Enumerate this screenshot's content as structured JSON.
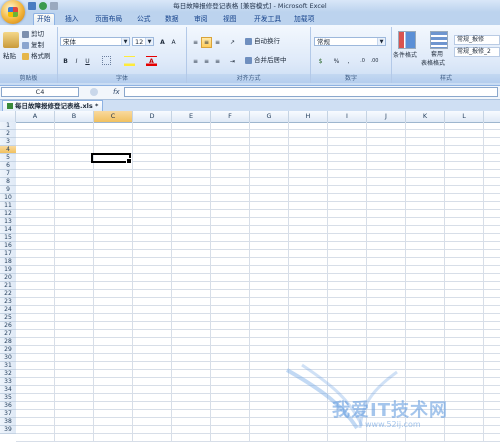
{
  "window": {
    "title": "每日故障报修登记表格 [兼容模式] - Microsoft Excel"
  },
  "tabs": [
    {
      "label": "开始",
      "active": true
    },
    {
      "label": "插入"
    },
    {
      "label": "页面布局"
    },
    {
      "label": "公式"
    },
    {
      "label": "数据"
    },
    {
      "label": "审阅"
    },
    {
      "label": "视图"
    },
    {
      "label": "开发工具"
    },
    {
      "label": "加载项"
    }
  ],
  "clipboard": {
    "paste": "粘贴",
    "cut": "剪切",
    "copy": "复制",
    "format_painter": "格式刷",
    "group_label": "剪贴板"
  },
  "font": {
    "name": "宋体",
    "size": "12",
    "bold": "B",
    "italic": "I",
    "underline": "U",
    "font_color": "A",
    "group_label": "字体"
  },
  "alignment": {
    "wrap_text": "自动换行",
    "merge_center": "合并后居中",
    "group_label": "对齐方式"
  },
  "number": {
    "format": "常规",
    "percent": "%",
    "comma": ",",
    "group_label": "数字"
  },
  "styles": {
    "conditional": "条件格式",
    "table_format_1": "套用",
    "table_format_2": "表格格式",
    "style_1": "常规_报修",
    "style_2": "常规_报修_2",
    "group_label": "样式"
  },
  "formula_bar": {
    "name_box": "C4",
    "fx": "fx"
  },
  "document_tab": {
    "label": "每日故障报修登记表格.xls *"
  },
  "grid": {
    "columns": [
      "A",
      "B",
      "C",
      "D",
      "E",
      "F",
      "G",
      "H",
      "I",
      "J",
      "K",
      "L"
    ],
    "selected_column": "C",
    "rows": [
      "1",
      "2",
      "3",
      "4",
      "5",
      "6",
      "7",
      "8",
      "9",
      "10",
      "11",
      "12",
      "13",
      "14",
      "15",
      "16",
      "17",
      "18",
      "19",
      "20",
      "21",
      "22",
      "23",
      "24",
      "25",
      "26",
      "27",
      "28",
      "29",
      "30",
      "31",
      "32",
      "33",
      "34",
      "35",
      "36",
      "37",
      "38",
      "39"
    ],
    "selected_row": "4",
    "active_cell": "C4"
  },
  "watermark": {
    "text": "我爱IT技术网",
    "url": "www.52ij.com"
  },
  "colors": {
    "accent": "#15428b",
    "ribbon_bg": "#dfeaf9",
    "selected_header": "#f1c15f",
    "grid_line": "#d7dee8"
  }
}
